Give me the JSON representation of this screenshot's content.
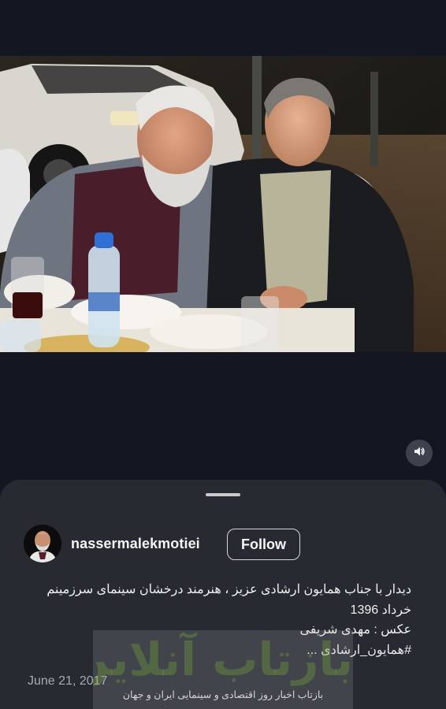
{
  "post": {
    "username": "nassermalekmotiei",
    "follow_label": "Follow",
    "caption_lines": [
      "دیدار با جناب همایون ارشادی عزیز ،  هنرمند درخشان سینمای سرزمینم",
      "خرداد 1396",
      "عکس :  مهدی شریفی",
      "#همایون_ارشادی ..."
    ],
    "date": "June 21, 2017"
  },
  "icons": {
    "volume": "speaker-muted-icon",
    "avatar": "profile-avatar"
  },
  "watermark": {
    "title": "بازتاب آنلاین",
    "tagline": "بازتاب اخبار روز اقتصادی و سینمایی ایران و جهان"
  },
  "colors": {
    "background": "#121722",
    "sheet": "#272a31",
    "text": "#f2f2f2",
    "muted_text": "#a9abb0"
  }
}
